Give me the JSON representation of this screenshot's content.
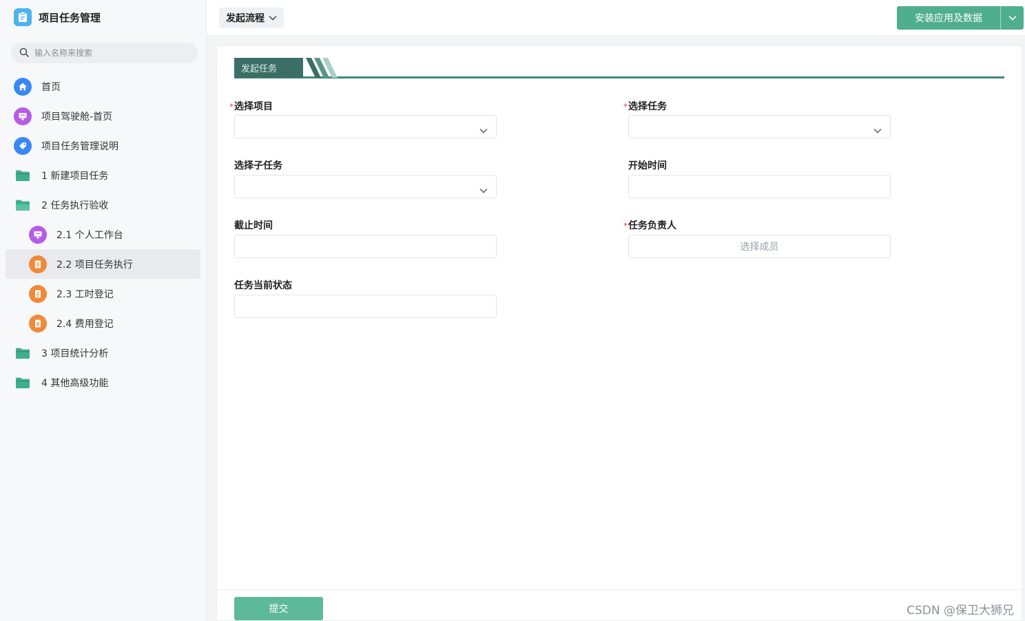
{
  "app": {
    "title": "项目任务管理",
    "logo_icon": "clipboard-icon"
  },
  "search": {
    "placeholder": "输入名称来搜索"
  },
  "sidebar": {
    "items": [
      {
        "label": "首页",
        "icon": "home-icon",
        "color": "#3a86f5"
      },
      {
        "label": "项目驾驶舱-首页",
        "icon": "dashboard-icon",
        "color": "#b55be7"
      },
      {
        "label": "项目任务管理说明",
        "icon": "tag-icon",
        "color": "#3a86f5"
      },
      {
        "label": "1 新建项目任务",
        "icon": "folder-icon",
        "color": "#3fae8c"
      },
      {
        "label": "2 任务执行验收",
        "icon": "folder-open-icon",
        "color": "#3fae8c"
      },
      {
        "label": "2.1 个人工作台",
        "icon": "dashboard-icon",
        "color": "#b55be7"
      },
      {
        "label": "2.2 项目任务执行",
        "icon": "document-icon",
        "color": "#f08a3a",
        "active": true
      },
      {
        "label": "2.3 工时登记",
        "icon": "document-icon",
        "color": "#f08a3a"
      },
      {
        "label": "2.4 费用登记",
        "icon": "expense-icon",
        "color": "#f08a3a"
      },
      {
        "label": "3 项目统计分析",
        "icon": "folder-icon",
        "color": "#3fae8c"
      },
      {
        "label": "4 其他高级功能",
        "icon": "folder-icon",
        "color": "#3fae8c"
      }
    ]
  },
  "topbar": {
    "flow_label": "发起流程",
    "install_label": "安装应用及数据"
  },
  "form": {
    "section_title": "发起任务",
    "fields": {
      "project": {
        "label": "选择项目",
        "required": true,
        "value": ""
      },
      "task": {
        "label": "选择任务",
        "required": true,
        "value": ""
      },
      "subtask": {
        "label": "选择子任务",
        "required": false,
        "value": ""
      },
      "start_time": {
        "label": "开始时间",
        "required": false,
        "value": ""
      },
      "end_time": {
        "label": "截止时间",
        "required": false,
        "value": ""
      },
      "owner": {
        "label": "任务负责人",
        "required": true,
        "button_label": "选择成员"
      },
      "status": {
        "label": "任务当前状态",
        "required": false,
        "value": ""
      }
    },
    "required_mark": "*",
    "submit_label": "提交"
  },
  "watermark": "CSDN @保卫大狮兄",
  "colors": {
    "accent": "#4fae8e",
    "section_dark": "#3b6f66",
    "required": "#e0453a"
  }
}
